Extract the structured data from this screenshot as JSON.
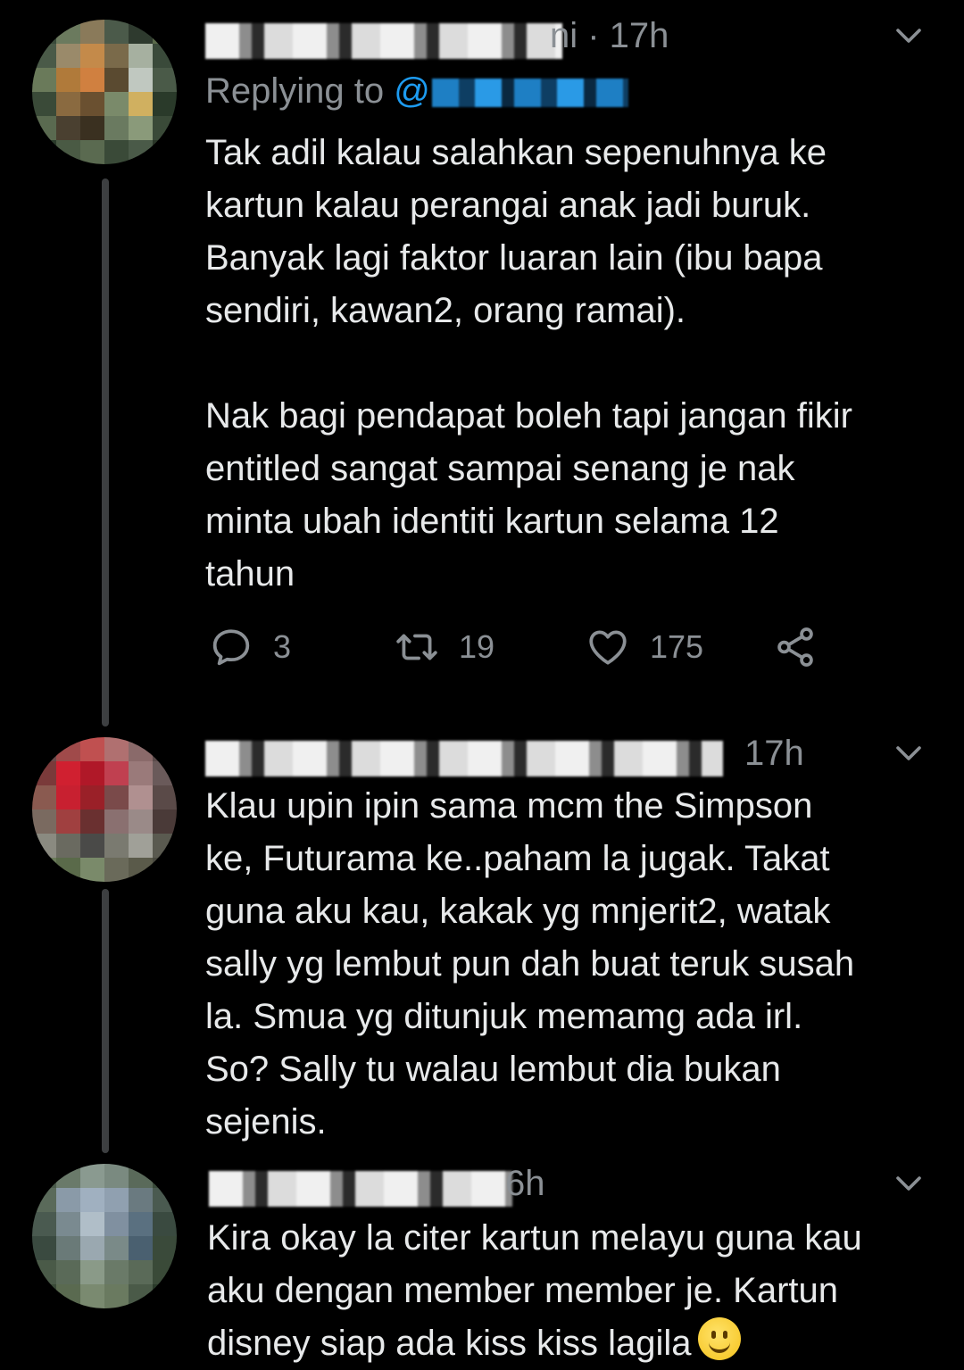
{
  "tweets": [
    {
      "time": "ni · 17h",
      "replying_prefix": "Replying to ",
      "replying_handle_prefix": "@",
      "text": "Tak adil kalau salahkan sepenuhnya ke\nkartun kalau perangai anak jadi buruk.\nBanyak lagi faktor luaran lain (ibu bapa\nsendiri, kawan2, orang ramai).\n\nNak bagi pendapat boleh tapi jangan fikir\nentitled sangat sampai senang je nak\nminta ubah identiti kartun selama 12\ntahun",
      "replies": "3",
      "retweets": "19",
      "likes": "175"
    },
    {
      "time": "17h",
      "text": "Klau upin ipin sama mcm the Simpson\nke, Futurama ke..paham la jugak. Takat\nguna aku kau, kakak yg mnjerit2, watak\nsally yg lembut pun dah buat teruk susah\nla. Smua yg ditunjuk memamg ada irl.\nSo? Sally tu walau lembut dia bukan\nsejenis."
    },
    {
      "time": "6h",
      "text": "Kira okay la citer kartun melayu guna kau\naku dengan member member je. Kartun\ndisney siap ada kiss kiss lagila"
    }
  ],
  "icons": {
    "reply": "reply-icon",
    "retweet": "retweet-icon",
    "like": "like-icon",
    "share": "share-icon",
    "more": "chevron-down-icon",
    "emoji": "slightly-smiling-face-emoji"
  },
  "colors": {
    "background": "#000000",
    "text": "#e7e9ea",
    "secondary": "#8b9095",
    "link": "#1d9bf0"
  }
}
